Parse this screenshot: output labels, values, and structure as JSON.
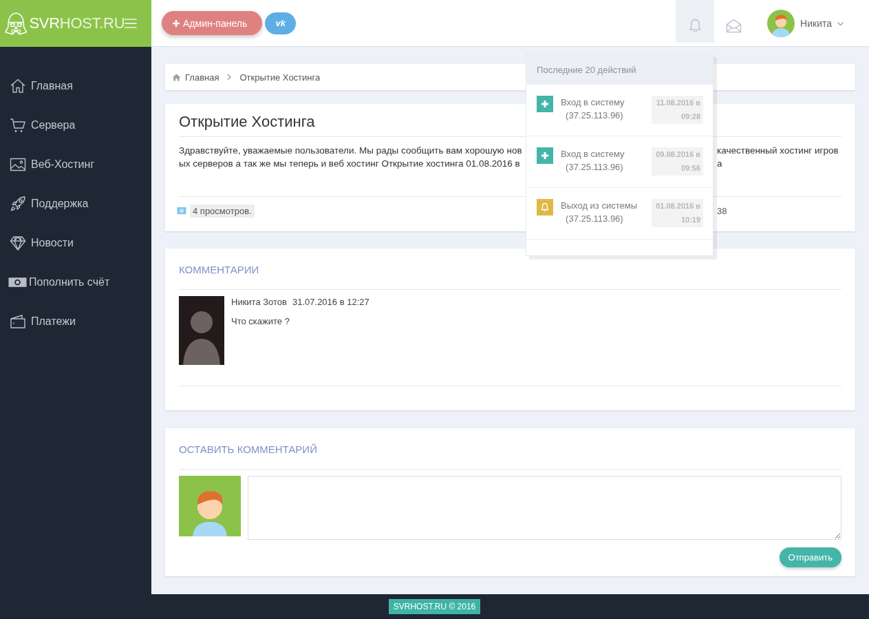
{
  "sidebar": {
    "logo": "**SVR**HOST.RU",
    "items": [
      {
        "label": "Главная",
        "selected": false
      },
      {
        "label": "Сервера",
        "selected": false
      },
      {
        "label": "Веб-Хостинг",
        "selected": false
      },
      {
        "label": "Поддержка",
        "selected": false
      },
      {
        "label": "Новости",
        "selected": false
      },
      {
        "label": "Пополнить счёт",
        "selected": false
      },
      {
        "label": "Платежи",
        "selected": false
      }
    ]
  },
  "header": {
    "admin_button": "Админ-панель",
    "social_button": "vk",
    "notifications": {
      "expanded": true,
      "title": "Последние 20 действий",
      "items": [
        {
          "kind": "login",
          "action": "Вход в систему",
          "ip": "(37.25.113.96)",
          "date": "11.08.2016 в",
          "time": "09:28"
        },
        {
          "kind": "login",
          "action": "Вход в систему",
          "ip": "(37.25.113.96)",
          "date": "09.08.2016 в",
          "time": "09:56"
        },
        {
          "kind": "logout",
          "action": "Выход из системы",
          "ip": "(37.25.113.96)",
          "date": "01.08.2016 в",
          "time": "10:19"
        }
      ]
    },
    "user": {
      "name": "Никита"
    }
  },
  "breadcrumb": [
    {
      "label": "Главная"
    },
    {
      "label": "Открытие Хостинга"
    }
  ],
  "article": {
    "title": "Открытие Хостинга",
    "lines": [
      {
        "start": "Здравствуйте, уважаемые пользователи. Мы рады сообщить вам хорошую нов",
        "end": "качественный хостинг игров"
      },
      {
        "start": "ых серверов а так же мы теперь и веб хостинг Открытие хостинга 01.08.2016 в",
        "end": "а"
      }
    ],
    "views": "4 просмотров.",
    "meta_end": "38"
  },
  "comments": {
    "heading": "КОММЕНТАРИИ",
    "items": [
      {
        "author": "Никита Зотов",
        "date": "31.07.2016 в 12:27",
        "text": "Что скажите ?"
      }
    ]
  },
  "comment_form": {
    "heading": "ОСТАВИТЬ КОММЕНТАРИЙ",
    "submit": "Отправить"
  },
  "footer": {
    "copyright": "SVRHOST.RU © 2016"
  }
}
